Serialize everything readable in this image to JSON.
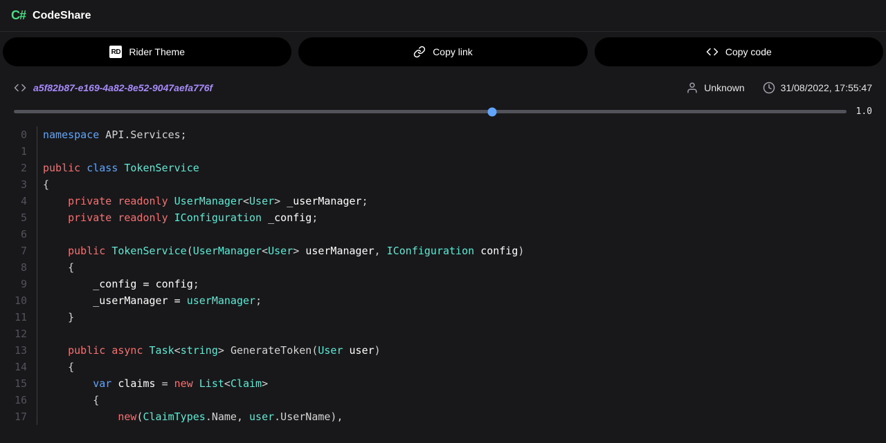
{
  "header": {
    "logo_text": "C#",
    "app_title": "CodeShare"
  },
  "toolbar": {
    "theme_btn": "Rider Theme",
    "copy_link_btn": "Copy link",
    "copy_code_btn": "Copy code"
  },
  "meta": {
    "snippet_id": "a5f82b87-e169-4a82-8e52-9047aefa776f",
    "author": "Unknown",
    "timestamp": "31/08/2022, 17:55:47"
  },
  "slider": {
    "value_label": "1.0"
  },
  "code": {
    "line_numbers": [
      "0",
      "1",
      "2",
      "3",
      "4",
      "5",
      "6",
      "7",
      "8",
      "9",
      "10",
      "11",
      "12",
      "13",
      "14",
      "15",
      "16",
      "17"
    ],
    "lines": [
      [
        {
          "t": "namespace",
          "c": "tk-kw"
        },
        {
          "t": " API.Services;",
          "c": "tk-ns"
        }
      ],
      [],
      [
        {
          "t": "public",
          "c": "tk-mod"
        },
        {
          "t": " ",
          "c": ""
        },
        {
          "t": "class",
          "c": "tk-kw"
        },
        {
          "t": " ",
          "c": ""
        },
        {
          "t": "TokenService",
          "c": "tk-type"
        }
      ],
      [
        {
          "t": "{",
          "c": "tk-punc"
        }
      ],
      [
        {
          "t": "    ",
          "c": ""
        },
        {
          "t": "private",
          "c": "tk-mod"
        },
        {
          "t": " ",
          "c": ""
        },
        {
          "t": "readonly",
          "c": "tk-mod"
        },
        {
          "t": " ",
          "c": ""
        },
        {
          "t": "UserManager",
          "c": "tk-type"
        },
        {
          "t": "<",
          "c": "tk-punc"
        },
        {
          "t": "User",
          "c": "tk-type"
        },
        {
          "t": "> ",
          "c": "tk-punc"
        },
        {
          "t": "_userManager",
          "c": "tk-var"
        },
        {
          "t": ";",
          "c": "tk-punc"
        }
      ],
      [
        {
          "t": "    ",
          "c": ""
        },
        {
          "t": "private",
          "c": "tk-mod"
        },
        {
          "t": " ",
          "c": ""
        },
        {
          "t": "readonly",
          "c": "tk-mod"
        },
        {
          "t": " ",
          "c": ""
        },
        {
          "t": "IConfiguration",
          "c": "tk-type"
        },
        {
          "t": " ",
          "c": ""
        },
        {
          "t": "_config",
          "c": "tk-var"
        },
        {
          "t": ";",
          "c": "tk-punc"
        }
      ],
      [],
      [
        {
          "t": "    ",
          "c": ""
        },
        {
          "t": "public",
          "c": "tk-mod"
        },
        {
          "t": " ",
          "c": ""
        },
        {
          "t": "TokenService",
          "c": "tk-type"
        },
        {
          "t": "(",
          "c": "tk-punc"
        },
        {
          "t": "UserManager",
          "c": "tk-type"
        },
        {
          "t": "<",
          "c": "tk-punc"
        },
        {
          "t": "User",
          "c": "tk-type"
        },
        {
          "t": "> ",
          "c": "tk-punc"
        },
        {
          "t": "userManager",
          "c": "tk-var"
        },
        {
          "t": ", ",
          "c": "tk-punc"
        },
        {
          "t": "IConfiguration",
          "c": "tk-type"
        },
        {
          "t": " ",
          "c": ""
        },
        {
          "t": "config",
          "c": "tk-var"
        },
        {
          "t": ")",
          "c": "tk-punc"
        }
      ],
      [
        {
          "t": "    {",
          "c": "tk-punc"
        }
      ],
      [
        {
          "t": "        _config = ",
          "c": "tk-var"
        },
        {
          "t": "config",
          "c": "tk-var"
        },
        {
          "t": ";",
          "c": "tk-punc"
        }
      ],
      [
        {
          "t": "        _userManager = ",
          "c": "tk-var"
        },
        {
          "t": "userManager",
          "c": "tk-type"
        },
        {
          "t": ";",
          "c": "tk-punc"
        }
      ],
      [
        {
          "t": "    }",
          "c": "tk-punc"
        }
      ],
      [],
      [
        {
          "t": "    ",
          "c": ""
        },
        {
          "t": "public",
          "c": "tk-mod"
        },
        {
          "t": " ",
          "c": ""
        },
        {
          "t": "async",
          "c": "tk-mod"
        },
        {
          "t": " ",
          "c": ""
        },
        {
          "t": "Task",
          "c": "tk-type"
        },
        {
          "t": "<",
          "c": "tk-punc"
        },
        {
          "t": "string",
          "c": "tk-str"
        },
        {
          "t": "> ",
          "c": "tk-punc"
        },
        {
          "t": "GenerateToken",
          "c": "tk-fn"
        },
        {
          "t": "(",
          "c": "tk-punc"
        },
        {
          "t": "User",
          "c": "tk-type"
        },
        {
          "t": " ",
          "c": ""
        },
        {
          "t": "user",
          "c": "tk-var"
        },
        {
          "t": ")",
          "c": "tk-punc"
        }
      ],
      [
        {
          "t": "    {",
          "c": "tk-punc"
        }
      ],
      [
        {
          "t": "        ",
          "c": ""
        },
        {
          "t": "var",
          "c": "tk-kw"
        },
        {
          "t": " ",
          "c": ""
        },
        {
          "t": "claims",
          "c": "tk-var"
        },
        {
          "t": " = ",
          "c": "tk-punc"
        },
        {
          "t": "new",
          "c": "tk-mod"
        },
        {
          "t": " ",
          "c": ""
        },
        {
          "t": "List",
          "c": "tk-type"
        },
        {
          "t": "<",
          "c": "tk-punc"
        },
        {
          "t": "Claim",
          "c": "tk-type"
        },
        {
          "t": ">",
          "c": "tk-punc"
        }
      ],
      [
        {
          "t": "        {",
          "c": "tk-punc"
        }
      ],
      [
        {
          "t": "            ",
          "c": ""
        },
        {
          "t": "new",
          "c": "tk-mod"
        },
        {
          "t": "(",
          "c": "tk-punc"
        },
        {
          "t": "ClaimTypes",
          "c": "tk-type"
        },
        {
          "t": ".Name, ",
          "c": "tk-punc"
        },
        {
          "t": "user",
          "c": "tk-type"
        },
        {
          "t": ".UserName),",
          "c": "tk-punc"
        }
      ]
    ]
  }
}
